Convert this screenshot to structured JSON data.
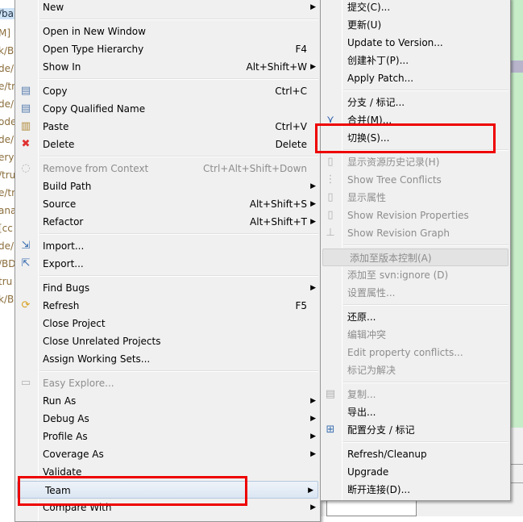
{
  "background_fragments": [
    "/ba",
    "M]",
    "k/B",
    "de/",
    "e/tr",
    "de/",
    "ode",
    "de/",
    "ery",
    "/tru",
    "e/tr",
    "ana",
    "[cc",
    "de/",
    "/BD",
    "tru",
    "k/B"
  ],
  "left_menu": [
    {
      "label": "New",
      "arrow": true
    },
    {
      "sep": true
    },
    {
      "label": "Open in New Window"
    },
    {
      "label": "Open Type Hierarchy",
      "shortcut": "F4"
    },
    {
      "label": "Show In",
      "shortcut": "Alt+Shift+W",
      "arrow": true
    },
    {
      "sep": true
    },
    {
      "label": "Copy",
      "shortcut": "Ctrl+C",
      "icon": "copy-icon"
    },
    {
      "label": "Copy Qualified Name",
      "icon": "copy-qualified-name-icon"
    },
    {
      "label": "Paste",
      "shortcut": "Ctrl+V",
      "icon": "paste-icon"
    },
    {
      "label": "Delete",
      "shortcut": "Delete",
      "icon": "delete-icon"
    },
    {
      "sep": true
    },
    {
      "label": "Remove from Context",
      "shortcut": "Ctrl+Alt+Shift+Down",
      "disabled": true,
      "icon": "remove-context-icon"
    },
    {
      "label": "Build Path",
      "arrow": true
    },
    {
      "label": "Source",
      "shortcut": "Alt+Shift+S",
      "arrow": true
    },
    {
      "label": "Refactor",
      "shortcut": "Alt+Shift+T",
      "arrow": true
    },
    {
      "sep": true
    },
    {
      "label": "Import...",
      "icon": "import-icon"
    },
    {
      "label": "Export...",
      "icon": "export-icon"
    },
    {
      "sep": true
    },
    {
      "label": "Find Bugs",
      "arrow": true
    },
    {
      "label": "Refresh",
      "shortcut": "F5",
      "icon": "refresh-icon"
    },
    {
      "label": "Close Project"
    },
    {
      "label": "Close Unrelated Projects"
    },
    {
      "label": "Assign Working Sets..."
    },
    {
      "sep": true
    },
    {
      "label": "Easy Explore...",
      "disabled": true,
      "icon": "folder-icon"
    },
    {
      "label": "Run As",
      "arrow": true
    },
    {
      "label": "Debug As",
      "arrow": true
    },
    {
      "label": "Profile As",
      "arrow": true
    },
    {
      "label": "Coverage As",
      "arrow": true
    },
    {
      "label": "Validate"
    },
    {
      "label": "Team",
      "arrow": true,
      "highlighted": true
    },
    {
      "label": "Compare With",
      "arrow": true
    }
  ],
  "right_menu": [
    {
      "label": "提交(C)..."
    },
    {
      "label": "更新(U)"
    },
    {
      "label": "Update to Version..."
    },
    {
      "label": "创建补丁(P)..."
    },
    {
      "label": "Apply Patch..."
    },
    {
      "sep": true
    },
    {
      "label": "分支 / 标记..."
    },
    {
      "label": "合并(M)...",
      "icon": "merge-icon"
    },
    {
      "label": "切换(S)..."
    },
    {
      "sep": true
    },
    {
      "label": "显示资源历史记录(H)",
      "disabled": true,
      "icon": "history-icon"
    },
    {
      "label": "Show Tree Conflicts",
      "disabled": true,
      "icon": "tree-conflicts-icon"
    },
    {
      "label": "显示属性",
      "disabled": true,
      "icon": "properties-icon"
    },
    {
      "label": "Show Revision Properties",
      "disabled": true,
      "icon": "revision-properties-icon"
    },
    {
      "label": "Show Revision Graph",
      "disabled": true,
      "icon": "revision-graph-icon"
    },
    {
      "sep": true
    },
    {
      "label": "添加至版本控制(A)",
      "disabled": true,
      "highlighted": true
    },
    {
      "label": "添加至 svn:ignore (D)",
      "disabled": true
    },
    {
      "label": "设置属性...",
      "disabled": true
    },
    {
      "sep": true
    },
    {
      "label": "还原..."
    },
    {
      "label": "编辑冲突",
      "disabled": true
    },
    {
      "label": "Edit property conflicts...",
      "disabled": true
    },
    {
      "label": "标记为解决",
      "disabled": true
    },
    {
      "sep": true
    },
    {
      "label": "复制...",
      "disabled": true,
      "icon": "copy-icon"
    },
    {
      "label": "导出..."
    },
    {
      "label": "配置分支 / 标记",
      "icon": "branch-config-icon"
    },
    {
      "sep": true
    },
    {
      "label": "Refresh/Cleanup"
    },
    {
      "label": "Upgrade"
    },
    {
      "label": "断开连接(D)..."
    }
  ],
  "icons": {
    "copy-icon": "▤",
    "copy-qualified-name-icon": "▤",
    "paste-icon": "▥",
    "delete-icon": "✖",
    "remove-context-icon": "◌",
    "import-icon": "⇲",
    "export-icon": "⇱",
    "refresh-icon": "⟳",
    "folder-icon": "▭",
    "merge-icon": "⋎",
    "history-icon": "▯",
    "tree-conflicts-icon": "⋮",
    "properties-icon": "▯",
    "revision-properties-icon": "▯",
    "revision-graph-icon": "⊥",
    "branch-config-icon": "⊞"
  },
  "icon_colors": {
    "delete-icon": "#e03030",
    "refresh-icon": "#d8a020",
    "merge-icon": "#2a5caa",
    "import-icon": "#3a6fb0",
    "export-icon": "#3a6fb0",
    "copy-icon": "#5a7fb0",
    "copy-qualified-name-icon": "#5a7fb0",
    "paste-icon": "#b08a3a",
    "branch-config-icon": "#3a6fb0"
  },
  "accent": "#e00000"
}
